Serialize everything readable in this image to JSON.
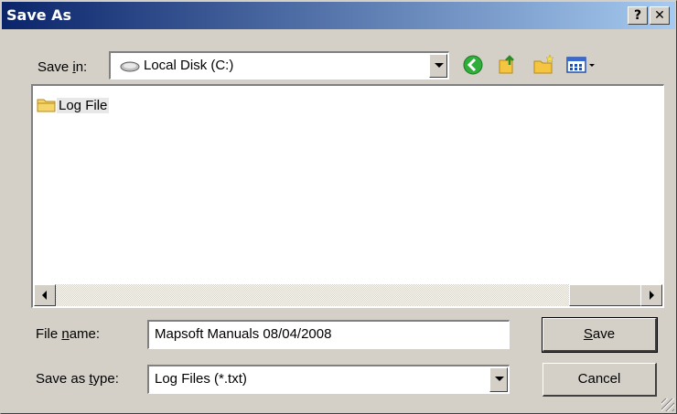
{
  "window": {
    "title": "Save As",
    "help_label": "?",
    "close_label": "✕"
  },
  "save_in": {
    "label_prefix": "Save ",
    "label_underline": "i",
    "label_suffix": "n:",
    "value": "Local Disk (C:)"
  },
  "toolbar": {
    "icons": [
      "back-icon",
      "up-folder-icon",
      "new-folder-icon",
      "views-menu-icon"
    ]
  },
  "file_list": {
    "items": [
      {
        "label": "Log File",
        "icon": "folder-icon"
      }
    ]
  },
  "file_name": {
    "label_prefix": "File ",
    "label_underline": "n",
    "label_suffix": "ame:",
    "value": "Mapsoft Manuals 08/04/2008"
  },
  "file_type": {
    "label_prefix": "Save as ",
    "label_underline": "t",
    "label_suffix": "ype:",
    "value": "Log Files (*.txt)"
  },
  "buttons": {
    "save_underline": "S",
    "save_rest": "ave",
    "cancel": "Cancel"
  }
}
